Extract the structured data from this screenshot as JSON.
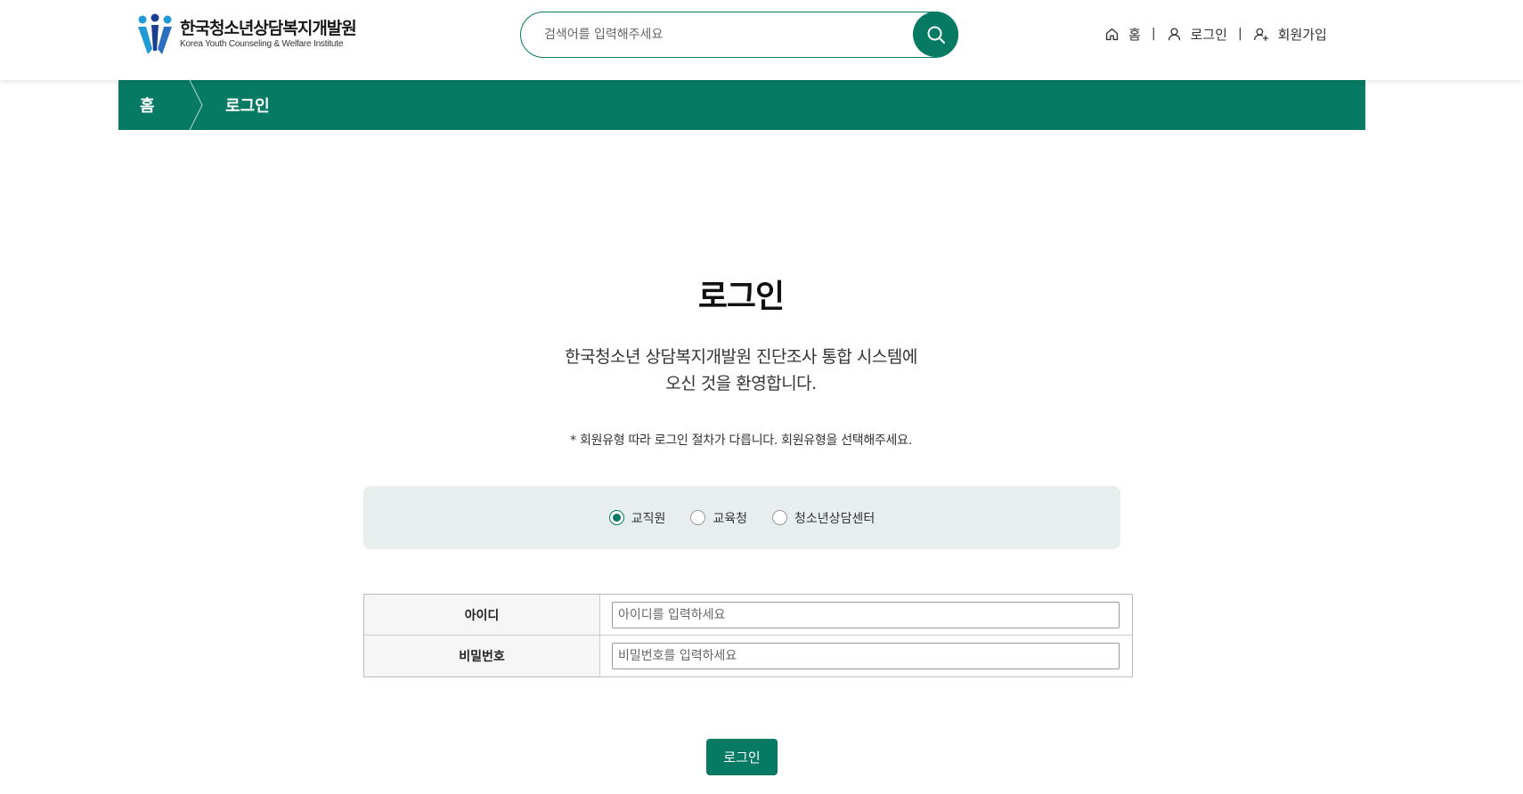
{
  "header": {
    "logo": {
      "name_kr": "한국청소년상담복지개발원",
      "name_en": "Korea Youth Counseling & Welfare Institute"
    },
    "search": {
      "placeholder": "검색어를 입력해주세요",
      "icon": "search-icon"
    },
    "nav": [
      {
        "label": "홈",
        "icon": "home-icon"
      },
      {
        "label": "로그인",
        "icon": "user-icon"
      },
      {
        "label": "회원가입",
        "icon": "user-add-icon"
      }
    ],
    "separator": "|"
  },
  "breadcrumb": {
    "home": "홈",
    "current": "로그인"
  },
  "main": {
    "title": "로그인",
    "welcome_line1": "한국청소년 상담복지개발원 진단조사 통합 시스템에",
    "welcome_line2": "오신 것을 환영합니다.",
    "notice": "* 회원유형 따라 로그인 절차가 다릅니다. 회원유형을 선택해주세요.",
    "member_types": [
      {
        "label": "교직원",
        "checked": true
      },
      {
        "label": "교육청",
        "checked": false
      },
      {
        "label": "청소년상담센터",
        "checked": false
      }
    ],
    "form": {
      "id_label": "아이디",
      "id_placeholder": "아이디를 입력하세요",
      "pw_label": "비밀번호",
      "pw_placeholder": "비밀번호를 입력하세요"
    },
    "login_button": "로그인"
  },
  "colors": {
    "primary": "#077a63",
    "type_box_bg": "#e7eeed"
  }
}
